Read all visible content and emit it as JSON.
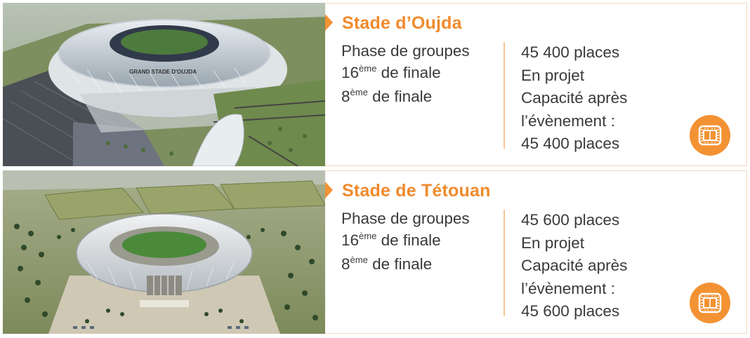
{
  "colors": {
    "accent": "#f39233",
    "title": "#f08a2c",
    "text": "#3a3a3a",
    "border": "#f6d8bf"
  },
  "stadiums": [
    {
      "name": "Stade d’Oujda",
      "photo_label": "GRAND STADE D'OUJDA",
      "phases": {
        "line1": "Phase de groupes",
        "line2_num": "16",
        "line2_sup": "ème",
        "line2_rest": " de finale",
        "line3_num": "8",
        "line3_sup": "ème",
        "line3_rest": " de finale"
      },
      "capacity": [
        "45 400 places",
        "En projet",
        "Capacité après",
        "l’évènement :",
        "45 400 places"
      ],
      "icon": "stadium-icon"
    },
    {
      "name": "Stade de Tétouan",
      "phases": {
        "line1": "Phase de groupes",
        "line2_num": "16",
        "line2_sup": "ème",
        "line2_rest": " de finale",
        "line3_num": "8",
        "line3_sup": "ème",
        "line3_rest": " de finale"
      },
      "capacity": [
        "45 600 places",
        "En projet",
        "Capacité après",
        "l’évènement :",
        "45 600 places"
      ],
      "icon": "stadium-icon"
    }
  ]
}
